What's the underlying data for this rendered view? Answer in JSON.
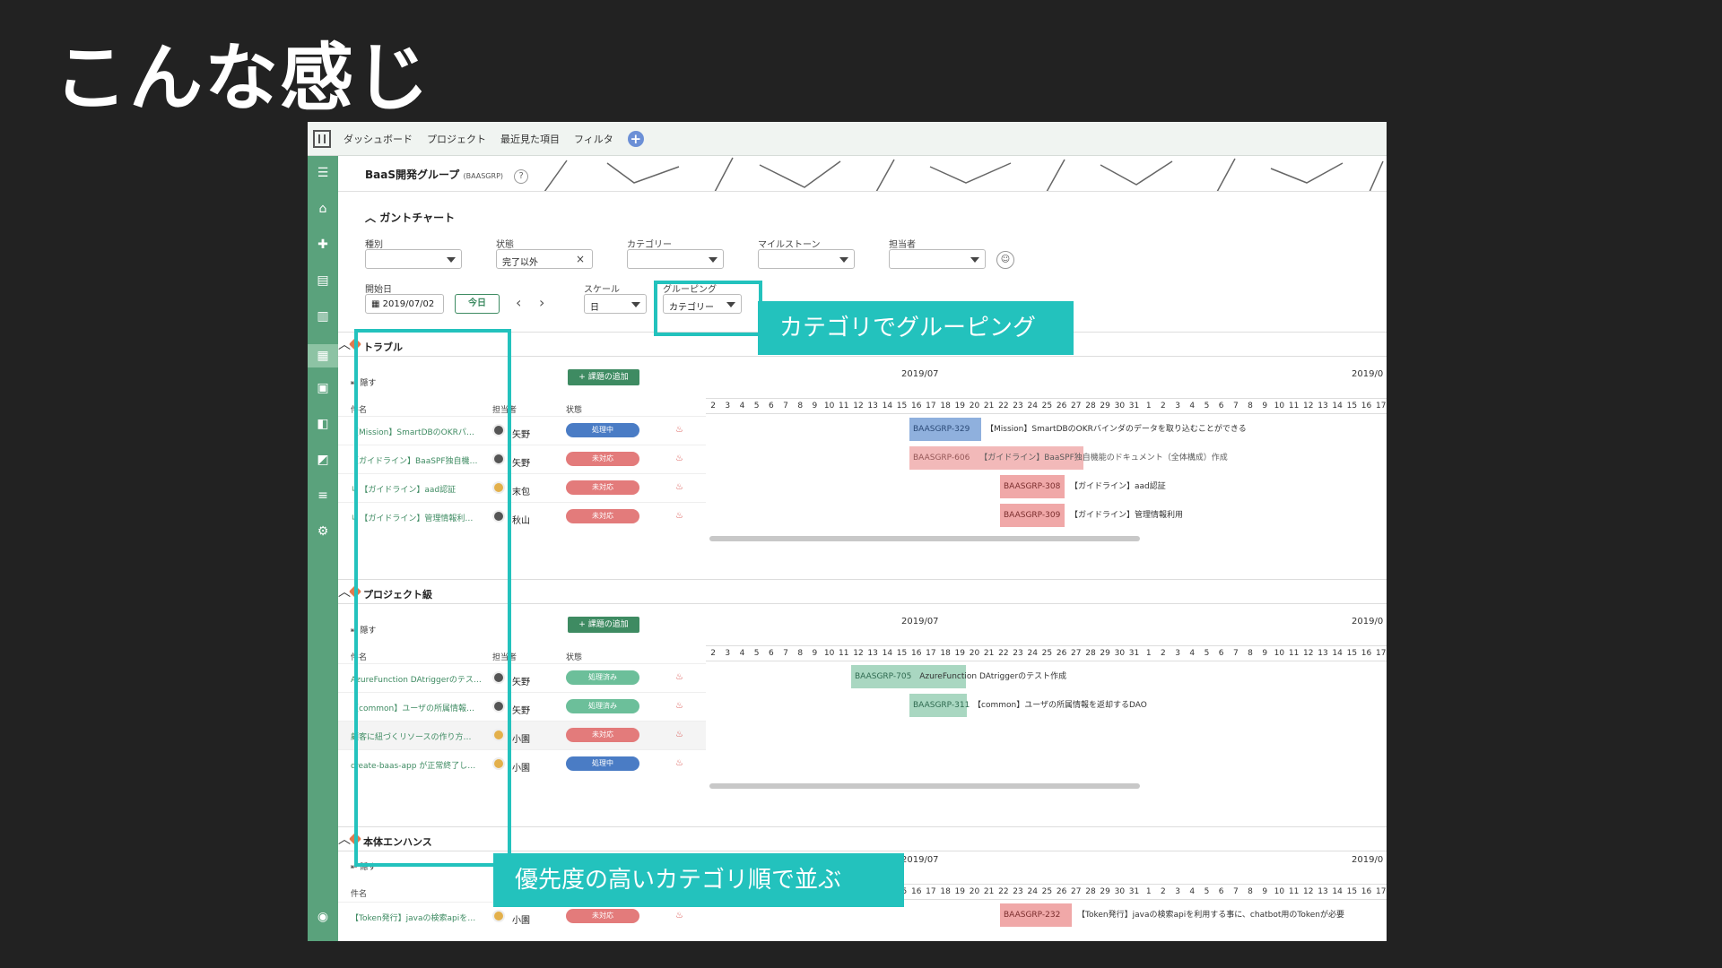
{
  "slide": {
    "title": "こんな感じ"
  },
  "topbar": {
    "nav": [
      "ダッシュボード",
      "プロジェクト",
      "最近見た項目",
      "フィルタ"
    ],
    "plus": "+"
  },
  "project": {
    "name": "BaaS開発グループ",
    "key": "(BAASGRP)",
    "help": "?"
  },
  "section": {
    "title": "ガントチャート"
  },
  "filters": {
    "type_label": "種別",
    "type_value": "",
    "status_label": "状態",
    "status_value": "完了以外",
    "category_label": "カテゴリー",
    "category_value": "",
    "milestone_label": "マイルストーン",
    "milestone_value": "",
    "assignee_label": "担当者",
    "assignee_value": "",
    "start_label": "開始日",
    "start_value": "2019/07/02",
    "today": "今日",
    "scale_label": "スケール",
    "scale_value": "日",
    "grouping_label": "グルーピング",
    "grouping_value": "カテゴリー"
  },
  "common": {
    "hide": "隠す",
    "add": "+ 課題の追加",
    "col_name": "件名",
    "col_assignee": "担当者",
    "col_status": "状態"
  },
  "callouts": {
    "grouping": "カテゴリでグルーピング",
    "order": "優先度の高いカテゴリ順で並ぶ"
  },
  "groups": [
    {
      "name": "トラブル",
      "month1": "2019/07",
      "month2": "2019/0",
      "rows": [
        {
          "name": "【Mission】SmartDBのOKRパ…",
          "person": "矢野",
          "status": "処理中",
          "color": "blue"
        },
        {
          "name": "【ガイドライン】BaaSPF独自機…",
          "person": "矢野",
          "status": "未対応",
          "color": "red"
        },
        {
          "name": "↳ 【ガイドライン】aad認証",
          "person": "末包",
          "status": "未対応",
          "color": "red"
        },
        {
          "name": "↳ 【ガイドライン】管理情報利…",
          "person": "秋山",
          "status": "未対応",
          "color": "red"
        }
      ],
      "bars": [
        {
          "key": "BAASGRP-329",
          "text": "【Mission】SmartDBのOKRバインダのデータを取り込むことができる"
        },
        {
          "key": "BAASGRP-606",
          "text": "【ガイドライン】BaaSPF独自機能のドキュメント（全体構成）作成"
        },
        {
          "key": "BAASGRP-308",
          "text": "【ガイドライン】aad認証"
        },
        {
          "key": "BAASGRP-309",
          "text": "【ガイドライン】管理情報利用"
        }
      ]
    },
    {
      "name": "プロジェクト級",
      "month1": "2019/07",
      "month2": "2019/0",
      "rows": [
        {
          "name": "AzureFunction DAtriggerのテス…",
          "person": "矢野",
          "status": "処理済み",
          "color": "teal"
        },
        {
          "name": "【common】ユーザの所属情報…",
          "person": "矢野",
          "status": "処理済み",
          "color": "teal"
        },
        {
          "name": "顧客に紐づくリソースの作り方…",
          "person": "小園",
          "status": "未対応",
          "color": "red"
        },
        {
          "name": "create-baas-app が正常終了し…",
          "person": "小園",
          "status": "処理中",
          "color": "blue"
        }
      ],
      "bars": [
        {
          "key": "BAASGRP-705",
          "text": "AzureFunction DAtriggerのテスト作成"
        },
        {
          "key": "BAASGRP-311",
          "text": "【common】ユーザの所属情報を返却するDAO"
        }
      ]
    },
    {
      "name": "本体エンハンス",
      "month1": "2019/07",
      "month2": "2019/0",
      "rows": [
        {
          "name": "【Token発行】javaの検索apiを…",
          "person": "小園",
          "status": "未対応",
          "color": "red"
        }
      ],
      "bars": [
        {
          "key": "BAASGRP-232",
          "text": "【Token発行】javaの検索apiを利用する事に、chatbot用のTokenが必要"
        }
      ]
    }
  ],
  "days_row": [
    "2",
    "3",
    "4",
    "5",
    "6",
    "7",
    "8",
    "9",
    "10",
    "11",
    "12",
    "13",
    "14",
    "15",
    "16",
    "17",
    "18",
    "19",
    "20",
    "21",
    "22",
    "23",
    "24",
    "25",
    "26",
    "27",
    "28",
    "29",
    "30",
    "31",
    "1",
    "2",
    "3",
    "4",
    "5",
    "6",
    "7",
    "8",
    "9",
    "10",
    "11",
    "12",
    "13",
    "14",
    "15",
    "16",
    "17"
  ],
  "colors": {
    "accent": "#23c2bd",
    "sidebar": "#5aa27c",
    "blue": "#4a7cc5",
    "red": "#e37b7b",
    "teal": "#6cbf9a"
  }
}
